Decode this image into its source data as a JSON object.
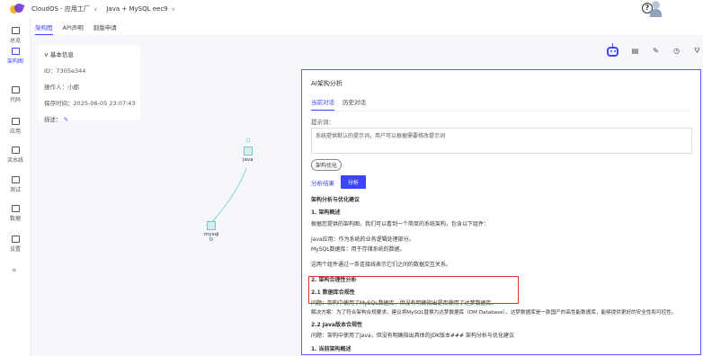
{
  "topbar": {
    "crumb1": "CloudOS - 应用工厂",
    "crumb2": "Java + MySQL eec9"
  },
  "sidebar": {
    "items": [
      {
        "label": "总览"
      },
      {
        "label": "架构图"
      },
      {
        "label": "代码"
      },
      {
        "label": "应用"
      },
      {
        "label": "流水线"
      },
      {
        "label": "测试"
      },
      {
        "label": "数据"
      },
      {
        "label": "设置"
      }
    ],
    "collapse": "«"
  },
  "tabs": [
    "架构图",
    "API声明",
    "割版申请"
  ],
  "info": {
    "title": "基本信息",
    "id": "ID：7305e344",
    "operator": "操作人：小郡",
    "saved": "保存时间：2025-06-05 23:07:43",
    "desc": "描述："
  },
  "nodes": {
    "java": "java",
    "mysql": "mysql"
  },
  "panel": {
    "title": "AI架构分析",
    "tabs": [
      "当前对话",
      "历史对话"
    ],
    "prompt_label": "提示词：",
    "prompt_text": "系统提供默认的提示词，用户可以根据需要修改提示词",
    "optimize": "架构优化",
    "result_label": "分析结果",
    "analyze": "分析",
    "lines": [
      "架构分析与优化建议",
      "1. 架构概述",
      "根据您提供的架构图，我们可以看到一个简单的系统架构，包含以下组件：",
      "Java应用：作为系统的业务逻辑处理部分。",
      "MySQL数据库：用于存储系统的数据。",
      "这两个组件通过一条连接线表示它们之间的数据交互关系。",
      "2. 架构合理性分析",
      "2.1 数据库合规性",
      "问题：架构中使用了MySQL数据库，但没有明确指出是否使用了达梦数据库。",
      "解决方案：为了符合架构合规要求，建议将MySQL替换为达梦数据库（DM Database）。达梦数据库是一款国产的高性能数据库，能够提供更好的安全性和可控性。",
      "2.2 Java版本合规性",
      "问题：架构中使用了Java，但没有明确指出具体的JDK版本### 架构分析与优化建议",
      "1. 当前架构概述"
    ]
  },
  "colors": {
    "accent": "#3d46ff",
    "highlight": "#e0322e"
  }
}
